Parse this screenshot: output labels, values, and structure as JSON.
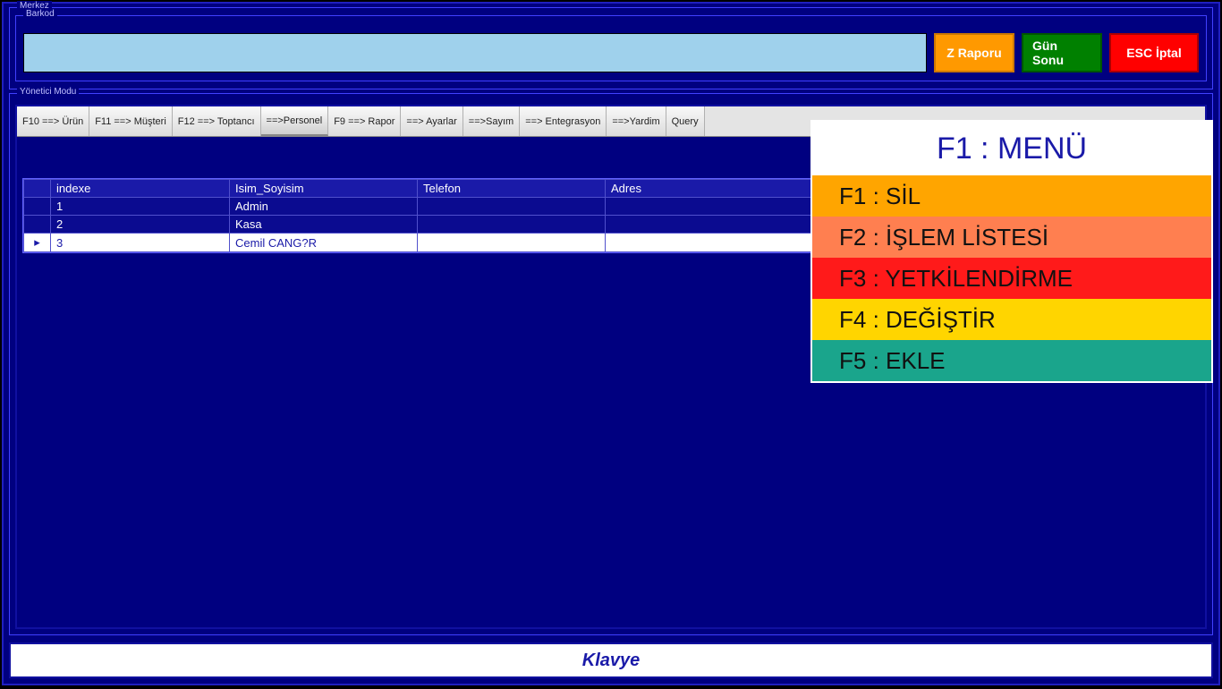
{
  "frames": {
    "merkez": "Merkez",
    "barkod": "Barkod",
    "yonetici": "Yönetici Modu"
  },
  "top_buttons": {
    "z_raporu": "Z Raporu",
    "gun_sonu": "Gün Sonu",
    "esc_iptal": "ESC İptal"
  },
  "tabs": [
    "F10 ==> Ürün",
    "F11 ==> Müşteri",
    "F12 ==> Toptancı",
    "==>Personel",
    "F9 ==> Rapor",
    "==> Ayarlar",
    "==>Sayım",
    "==> Entegrasyon",
    "==>Yardim",
    "Query"
  ],
  "active_tab_index": 3,
  "grid": {
    "columns": [
      "indexe",
      "Isim_Soyisim",
      "Telefon",
      "Adres"
    ],
    "rows": [
      {
        "indicator": "",
        "idx": "1",
        "name": "Admin",
        "tel": "",
        "adr": ""
      },
      {
        "indicator": "",
        "idx": "2",
        "name": "Kasa",
        "tel": "",
        "adr": ""
      },
      {
        "indicator": "▸",
        "idx": "3",
        "name": "Cemil CANG?R",
        "tel": "",
        "adr": ""
      }
    ],
    "selected_index": 2
  },
  "right_menu": {
    "header": "F1 : MENÜ",
    "items": [
      {
        "label": "F1 : SİL",
        "cls": "m-orange"
      },
      {
        "label": "F2 : İŞLEM LİSTESİ",
        "cls": "m-orange2"
      },
      {
        "label": "F3 : YETKİLENDİRME",
        "cls": "m-red"
      },
      {
        "label": "F4 : DEĞİŞTİR",
        "cls": "m-yellow"
      },
      {
        "label": "F5 : EKLE",
        "cls": "m-teal"
      }
    ]
  },
  "footer": {
    "klavye": "Klavye"
  }
}
